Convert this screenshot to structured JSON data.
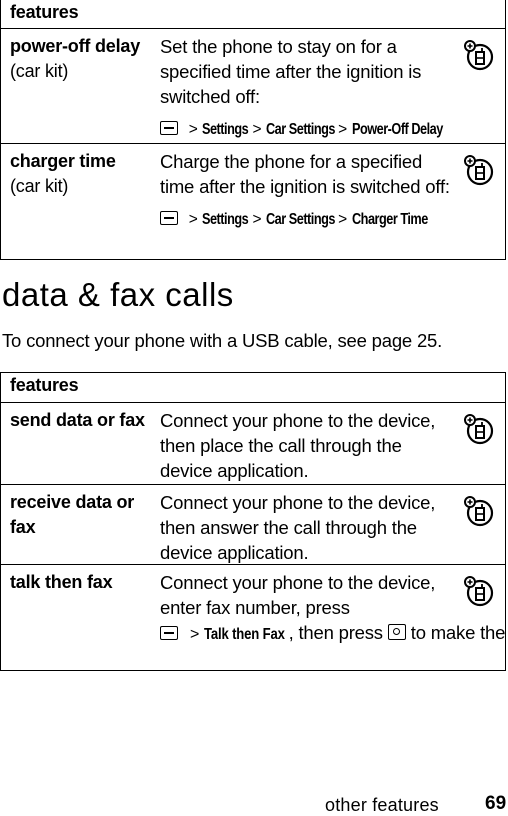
{
  "table1": {
    "header": "features",
    "rows": [
      {
        "feature_bold": "power-off delay",
        "feature_note": "(car kit)",
        "description": "Set the phone to stay on for a specified time after the ignition is switched off:",
        "path": [
          "Settings",
          "Car Settings",
          "Power-Off Delay"
        ],
        "icon": "network-phone-icon"
      },
      {
        "feature_bold": "charger time",
        "feature_note": "(car kit)",
        "description": "Charge the phone for a specified time after the ignition is switched off:",
        "path": [
          "Settings",
          "Car Settings",
          "Charger Time"
        ],
        "icon": "network-phone-icon"
      }
    ]
  },
  "section": {
    "title": "data & fax calls",
    "intro": "To connect your phone with a USB cable, see page 25."
  },
  "table2": {
    "header": "features",
    "rows": [
      {
        "feature_bold": "send data or fax",
        "description": "Connect your phone to the device, then place the call through the device application.",
        "icon": "network-phone-icon"
      },
      {
        "feature_bold": "receive data or fax",
        "description": "Connect your phone to the device, then answer the call through the device application.",
        "icon": "network-phone-icon"
      },
      {
        "feature_bold": "talk then fax",
        "description_before": "Connect your phone to the device, enter fax number, press",
        "menu_item": "Talk then Fax",
        "description_mid": ", then press",
        "description_after": "to make the call.",
        "icon": "network-phone-icon"
      }
    ]
  },
  "separator": ">",
  "footer": {
    "section_label": "other features",
    "page_number": "69"
  }
}
